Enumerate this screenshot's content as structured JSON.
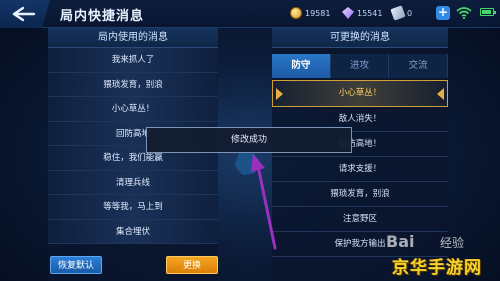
{
  "header": {
    "title": "局内快捷消息",
    "resources": {
      "gold": "19581",
      "gems": "15541",
      "tickets": "0"
    }
  },
  "left_panel": {
    "title": "局内使用的消息",
    "items": [
      "我来抓人了",
      "猥琐发育，别浪",
      "小心草丛！",
      "回防高地",
      "稳住，我们能赢",
      "清理兵线",
      "等等我，马上到",
      "集合埋伏"
    ]
  },
  "right_panel": {
    "title": "可更换的消息",
    "tabs": [
      {
        "label": "防守",
        "active": true
      },
      {
        "label": "进攻",
        "active": false
      },
      {
        "label": "交流",
        "active": false
      }
    ],
    "items": [
      "小心草丛！",
      "敌人消失！",
      "回防高地！",
      "请求支援！",
      "猥琐发育，别浪",
      "注意野区",
      "保护我方输出"
    ],
    "selected_index": 0
  },
  "buttons": {
    "restore_label": "恢复默认",
    "replace_label": "更换"
  },
  "toast": {
    "text": "修改成功"
  },
  "watermarks": {
    "baidu": "Bai",
    "baidu_suffix": "经验",
    "site": "京华手游网"
  },
  "colors": {
    "accent": "#2a77c9",
    "gold": "#e5b041",
    "replace": "#f5a623",
    "arrow": "#9b2fbf"
  }
}
